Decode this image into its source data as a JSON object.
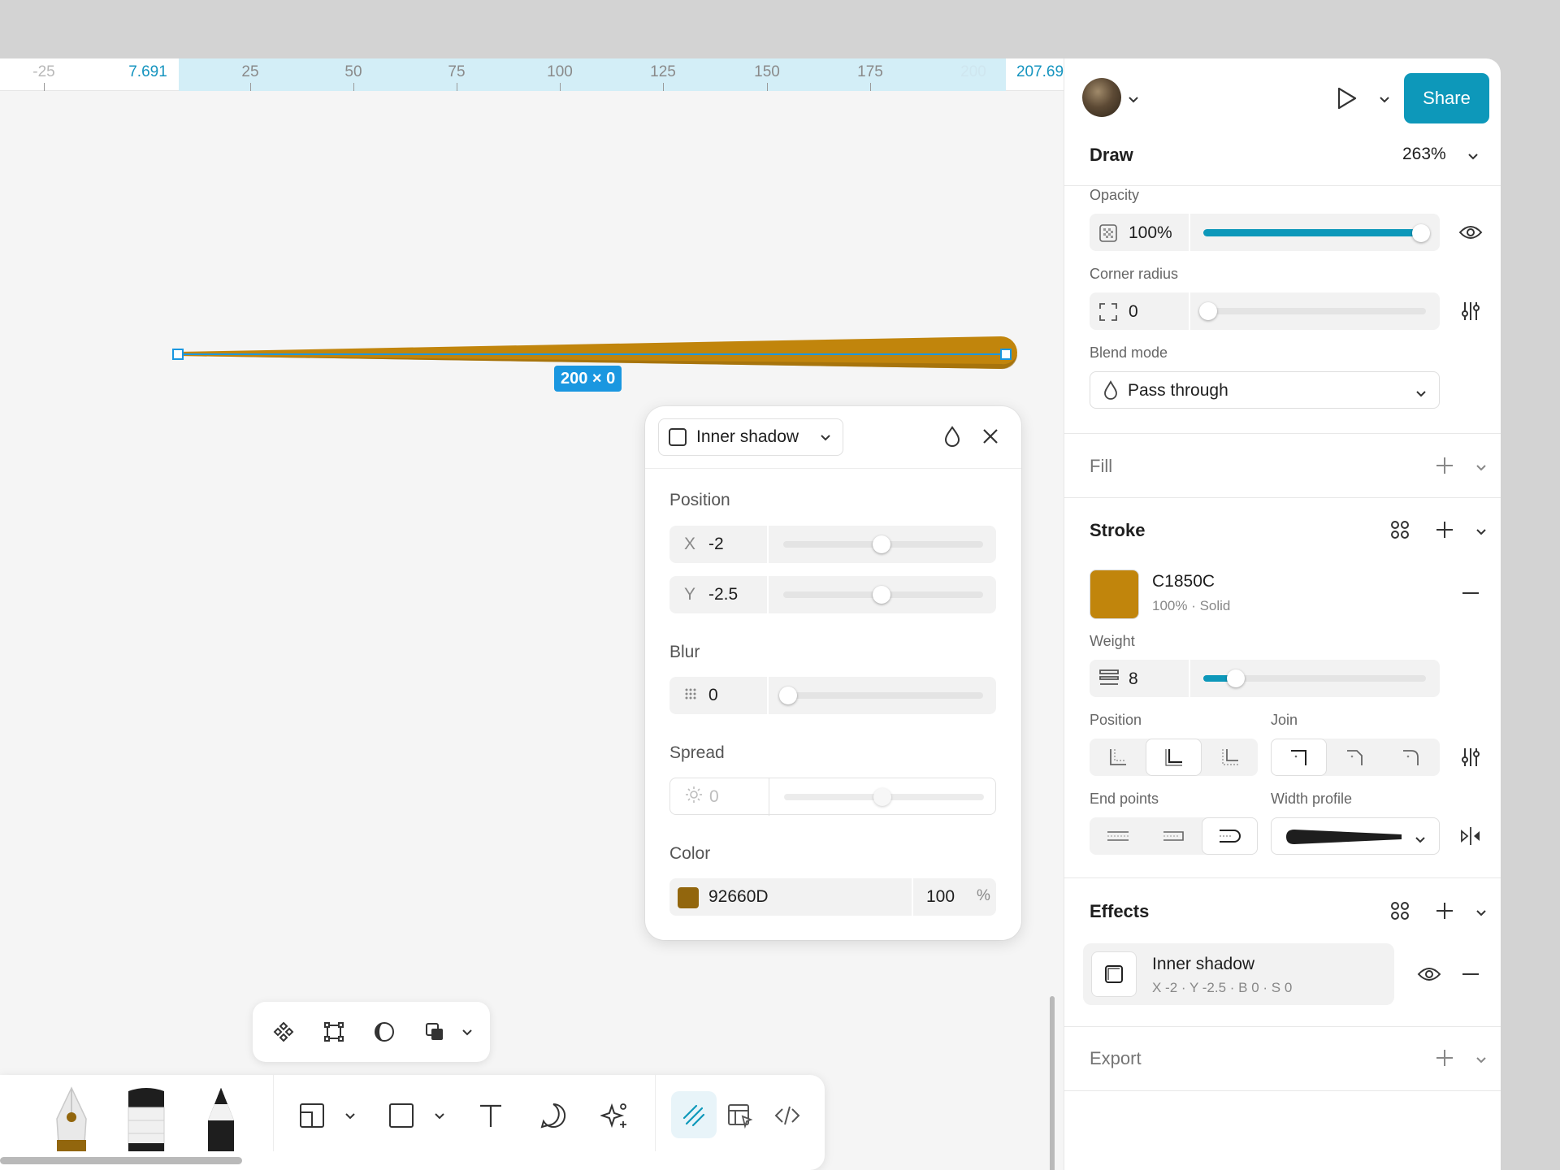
{
  "ruler": {
    "ticks": [
      "-25",
      "25",
      "50",
      "75",
      "100",
      "125",
      "150",
      "175",
      "200"
    ],
    "sel_start": "7.691",
    "sel_end": "207.69"
  },
  "object": {
    "size_label": "200 × 0",
    "color": "#C1850C"
  },
  "effect_popover": {
    "type_label": "Inner shadow",
    "position_label": "Position",
    "x_axis": "X",
    "x_value": "-2",
    "y_axis": "Y",
    "y_value": "-2.5",
    "blur_label": "Blur",
    "blur_value": "0",
    "spread_label": "Spread",
    "spread_value": "0",
    "color_label": "Color",
    "color_hex": "92660D",
    "color_opacity": "100",
    "percent_sign": "%"
  },
  "panel": {
    "share_label": "Share",
    "mode_title": "Draw",
    "zoom": "263%",
    "opacity_label": "Opacity",
    "opacity_value": "100%",
    "corner_label": "Corner radius",
    "corner_value": "0",
    "blend_label": "Blend mode",
    "blend_value": "Pass through",
    "fill_title": "Fill",
    "stroke_title": "Stroke",
    "stroke_hex": "C1850C",
    "stroke_meta": "100% · Solid",
    "weight_label": "Weight",
    "weight_value": "8",
    "position_label": "Position",
    "join_label": "Join",
    "endpoints_label": "End points",
    "width_profile_label": "Width profile",
    "effects_title": "Effects",
    "effect_name": "Inner shadow",
    "effect_meta": "X -2 · Y -2.5 · B 0 · S 0",
    "export_title": "Export"
  },
  "colors": {
    "accent": "#0D98BA",
    "stroke": "#C1850C",
    "shadow": "#92660D",
    "selection": "#1A97E0"
  }
}
